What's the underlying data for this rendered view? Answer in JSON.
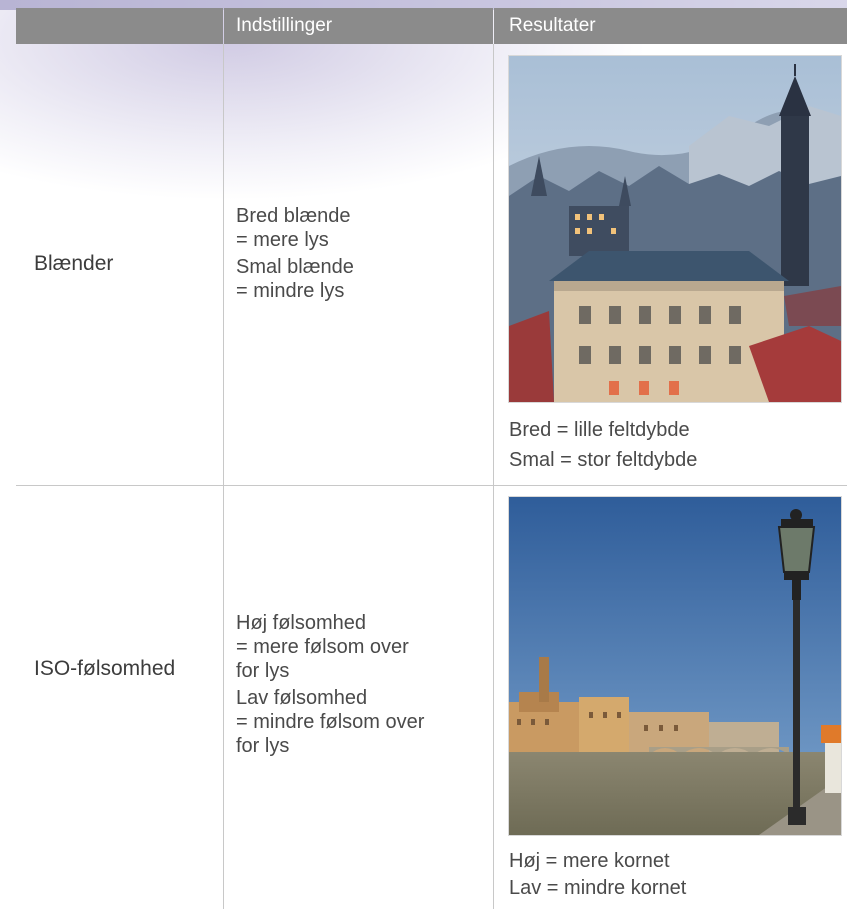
{
  "header": {
    "col_settings": "Indstillinger",
    "col_results": "Resultater"
  },
  "rows": [
    {
      "label": "Blænder",
      "settings": [
        "Bred blænde",
        "= mere lys",
        "Smal blænde",
        "= mindre lys"
      ],
      "image": "city-rooftops-photo",
      "results": [
        "Bred = lille feltdybde",
        "Smal = stor feltdybde"
      ]
    },
    {
      "label": "ISO-følsomhed",
      "settings": [
        "Høj følsomhed",
        "= mere følsom over",
        "for lys",
        "Lav følsomhed",
        "= mindre følsom over",
        "for lys"
      ],
      "image": "riverside-lamppost-photo",
      "results": [
        "Høj = mere kornet",
        "Lav = mindre kornet"
      ]
    }
  ],
  "colors": {
    "header_bg": "#8b8b8b",
    "grid_line": "#c8c8c8",
    "text": "#3c3c3c"
  }
}
